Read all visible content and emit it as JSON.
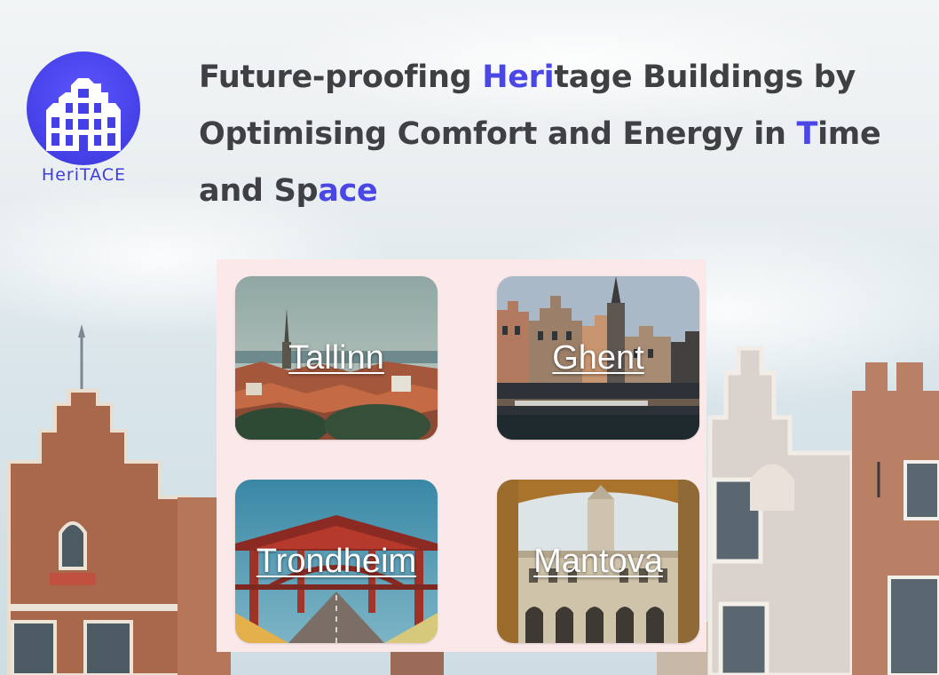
{
  "brand": {
    "logo_text": "HeriTACE",
    "accent_color": "#4a47e6"
  },
  "headline": {
    "line1_a": "Future-proofing ",
    "line1_hl": "Heri",
    "line1_b": "tage Buildings by",
    "line2_a": "Optimising Comfort and Energy in ",
    "line2_hl": "T",
    "line2_b": "ime",
    "line3_a": "and Sp",
    "line3_hl": "ace"
  },
  "cities": [
    {
      "name": "Tallinn"
    },
    {
      "name": "Ghent"
    },
    {
      "name": "Trondheim"
    },
    {
      "name": "Mantova"
    }
  ],
  "colors": {
    "panel_bg": "#fbe9ea",
    "headline_text": "#3e4043",
    "link_text": "#ffffff"
  }
}
